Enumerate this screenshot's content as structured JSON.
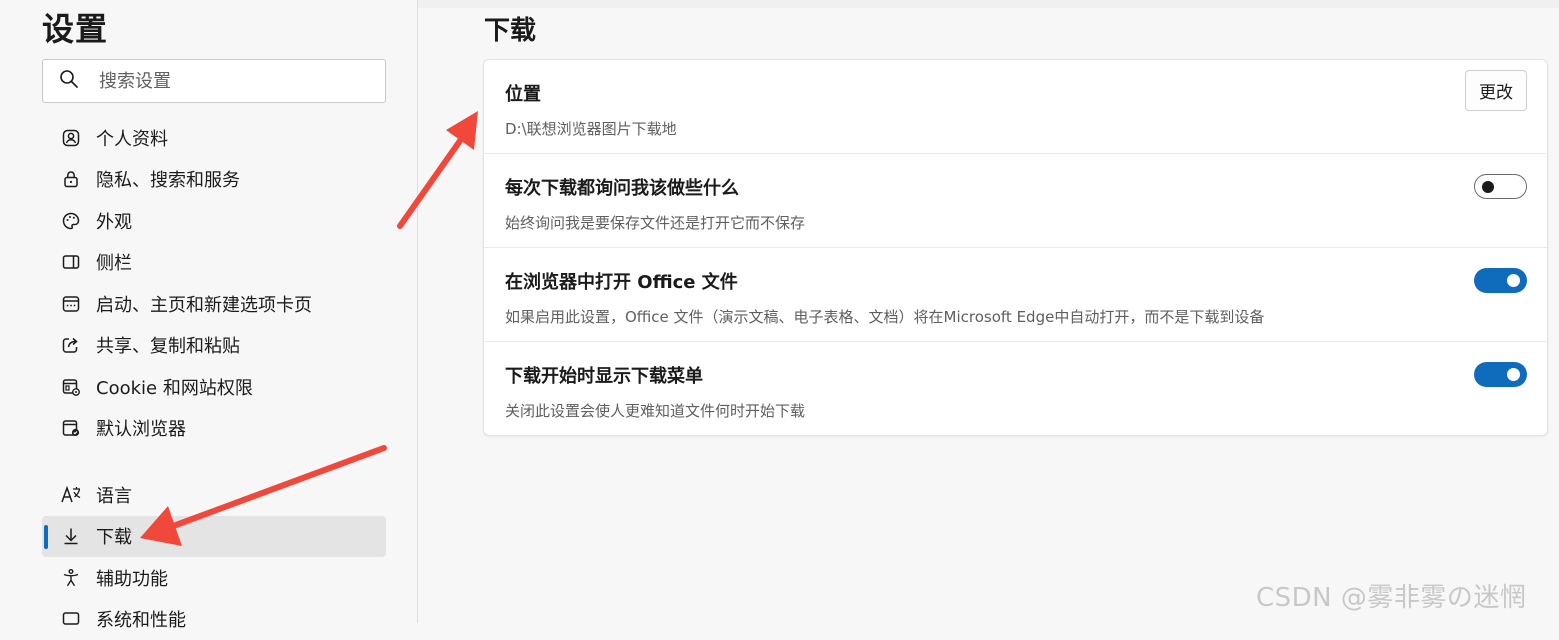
{
  "sidebar": {
    "title": "设置",
    "search_placeholder": "搜索设置",
    "items": [
      {
        "label": "个人资料",
        "icon": "profile-icon"
      },
      {
        "label": "隐私、搜索和服务",
        "icon": "lock-icon"
      },
      {
        "label": "外观",
        "icon": "palette-icon"
      },
      {
        "label": "侧栏",
        "icon": "sidebar-icon"
      },
      {
        "label": "启动、主页和新建选项卡页",
        "icon": "home-tab-icon"
      },
      {
        "label": "共享、复制和粘贴",
        "icon": "share-icon"
      },
      {
        "label": "Cookie 和网站权限",
        "icon": "cookie-permissions-icon"
      },
      {
        "label": "默认浏览器",
        "icon": "default-browser-icon"
      },
      {
        "label": "语言",
        "icon": "language-icon"
      },
      {
        "label": "下载",
        "icon": "download-icon",
        "active": true
      },
      {
        "label": "辅助功能",
        "icon": "accessibility-icon"
      },
      {
        "label": "系统和性能",
        "icon": "system-icon"
      }
    ]
  },
  "main": {
    "title": "下载",
    "rows": [
      {
        "title": "位置",
        "desc": "D:\\联想浏览器图片下载地",
        "control": "button",
        "button_label": "更改"
      },
      {
        "title": "每次下载都询问我该做些什么",
        "desc": "始终询问我是要保存文件还是打开它而不保存",
        "control": "toggle",
        "on": false
      },
      {
        "title": "在浏览器中打开 Office 文件",
        "desc": "如果启用此设置，Office 文件（演示文稿、电子表格、文档）将在Microsoft Edge中自动打开，而不是下载到设备",
        "control": "toggle",
        "on": true
      },
      {
        "title": "下载开始时显示下载菜单",
        "desc": "关闭此设置会使人更难知道文件何时开始下载",
        "control": "toggle",
        "on": true
      }
    ]
  },
  "watermark": "CSDN @雾非雾の迷惘",
  "colors": {
    "accent": "#0f6cbd",
    "annotation_arrow": "#f0493b"
  }
}
